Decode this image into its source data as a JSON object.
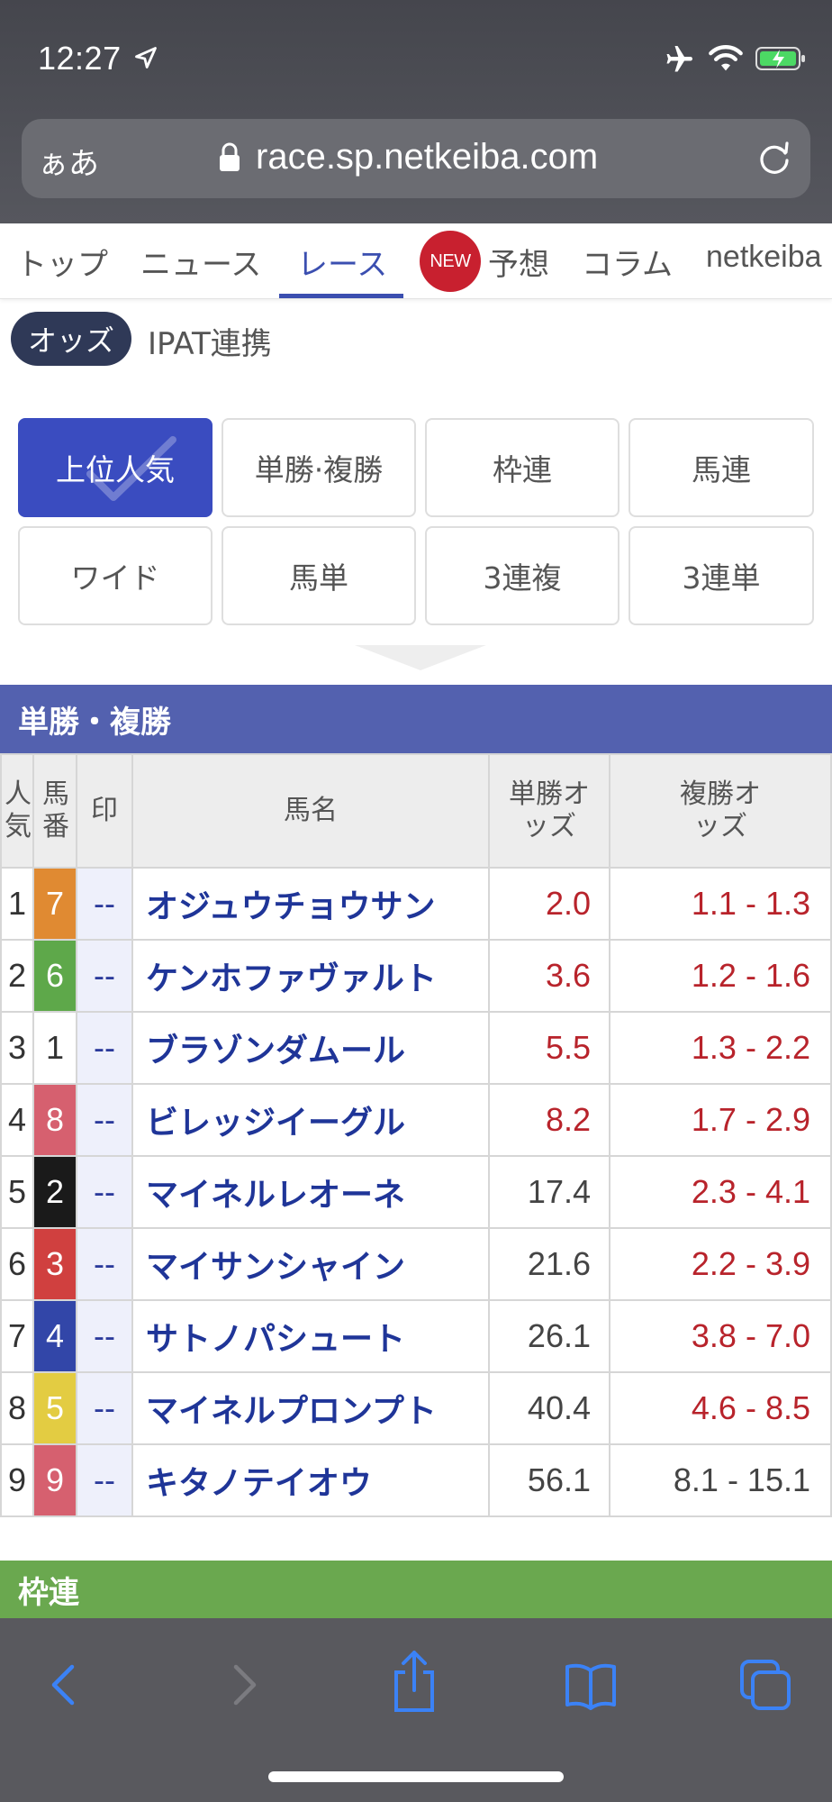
{
  "status_bar": {
    "time": "12:27"
  },
  "browser": {
    "aa_label": "ぁあ",
    "url": "race.sp.netkeiba.com"
  },
  "site_nav": {
    "items": [
      "トップ",
      "ニュース",
      "レース",
      "予想",
      "コラム",
      "netkeiba"
    ],
    "active": "レース",
    "new_badge": "NEW"
  },
  "sub_header": {
    "odds_label": "オッズ",
    "ipat_label": "IPAT連携"
  },
  "bet_types": {
    "row1": [
      "上位人気",
      "単勝·複勝",
      "枠連",
      "馬連"
    ],
    "row2": [
      "ワイド",
      "馬単",
      "3連複",
      "3連単"
    ],
    "active": "上位人気"
  },
  "section": {
    "title": "単勝・複勝",
    "next_title": "枠連"
  },
  "table": {
    "headers": {
      "pop": "人気",
      "num": "馬番",
      "mark": "印",
      "name": "馬名",
      "win": "単勝オッズ",
      "place": "複勝オッズ"
    },
    "rows": [
      {
        "pop": "1",
        "num": "7",
        "mark": "--",
        "name": "オジュウチョウサン",
        "win": "2.0",
        "place": "1.1 - 1.3",
        "num_color": "#e08a32",
        "num_text": "#ffffff",
        "win_hot": true,
        "place_hot": true
      },
      {
        "pop": "2",
        "num": "6",
        "mark": "--",
        "name": "ケンホファヴァルト",
        "win": "3.6",
        "place": "1.2 - 1.6",
        "num_color": "#5ea84a",
        "num_text": "#ffffff",
        "win_hot": true,
        "place_hot": true
      },
      {
        "pop": "3",
        "num": "1",
        "mark": "--",
        "name": "ブラゾンダムール",
        "win": "5.5",
        "place": "1.3 - 2.2",
        "num_color": "#ffffff",
        "num_text": "#333333",
        "win_hot": true,
        "place_hot": true
      },
      {
        "pop": "4",
        "num": "8",
        "mark": "--",
        "name": "ビレッジイーグル",
        "win": "8.2",
        "place": "1.7 - 2.9",
        "num_color": "#d6606f",
        "num_text": "#ffffff",
        "win_hot": true,
        "place_hot": true
      },
      {
        "pop": "5",
        "num": "2",
        "mark": "--",
        "name": "マイネルレオーネ",
        "win": "17.4",
        "place": "2.3 - 4.1",
        "num_color": "#1a1a1a",
        "num_text": "#ffffff",
        "win_hot": false,
        "place_hot": true
      },
      {
        "pop": "6",
        "num": "3",
        "mark": "--",
        "name": "マイサンシャイン",
        "win": "21.6",
        "place": "2.2 - 3.9",
        "num_color": "#d0403f",
        "num_text": "#ffffff",
        "win_hot": false,
        "place_hot": true
      },
      {
        "pop": "7",
        "num": "4",
        "mark": "--",
        "name": "サトノパシュート",
        "win": "26.1",
        "place": "3.8 - 7.0",
        "num_color": "#3246a8",
        "num_text": "#ffffff",
        "win_hot": false,
        "place_hot": true
      },
      {
        "pop": "8",
        "num": "5",
        "mark": "--",
        "name": "マイネルプロンプト",
        "win": "40.4",
        "place": "4.6 - 8.5",
        "num_color": "#e3cc42",
        "num_text": "#ffffff",
        "win_hot": false,
        "place_hot": true
      },
      {
        "pop": "9",
        "num": "9",
        "mark": "--",
        "name": "キタノテイオウ",
        "win": "56.1",
        "place": "8.1 - 15.1",
        "num_color": "#d6606f",
        "num_text": "#ffffff",
        "win_hot": false,
        "place_hot": false
      }
    ]
  },
  "colors": {
    "accent": "#3a4cc0",
    "odds_hot": "#b8232b",
    "section_blue": "#5361af",
    "section_green": "#6aa84f"
  },
  "toolbar_icons": [
    "back-icon",
    "forward-icon",
    "share-icon",
    "bookmarks-icon",
    "tabs-icon"
  ]
}
